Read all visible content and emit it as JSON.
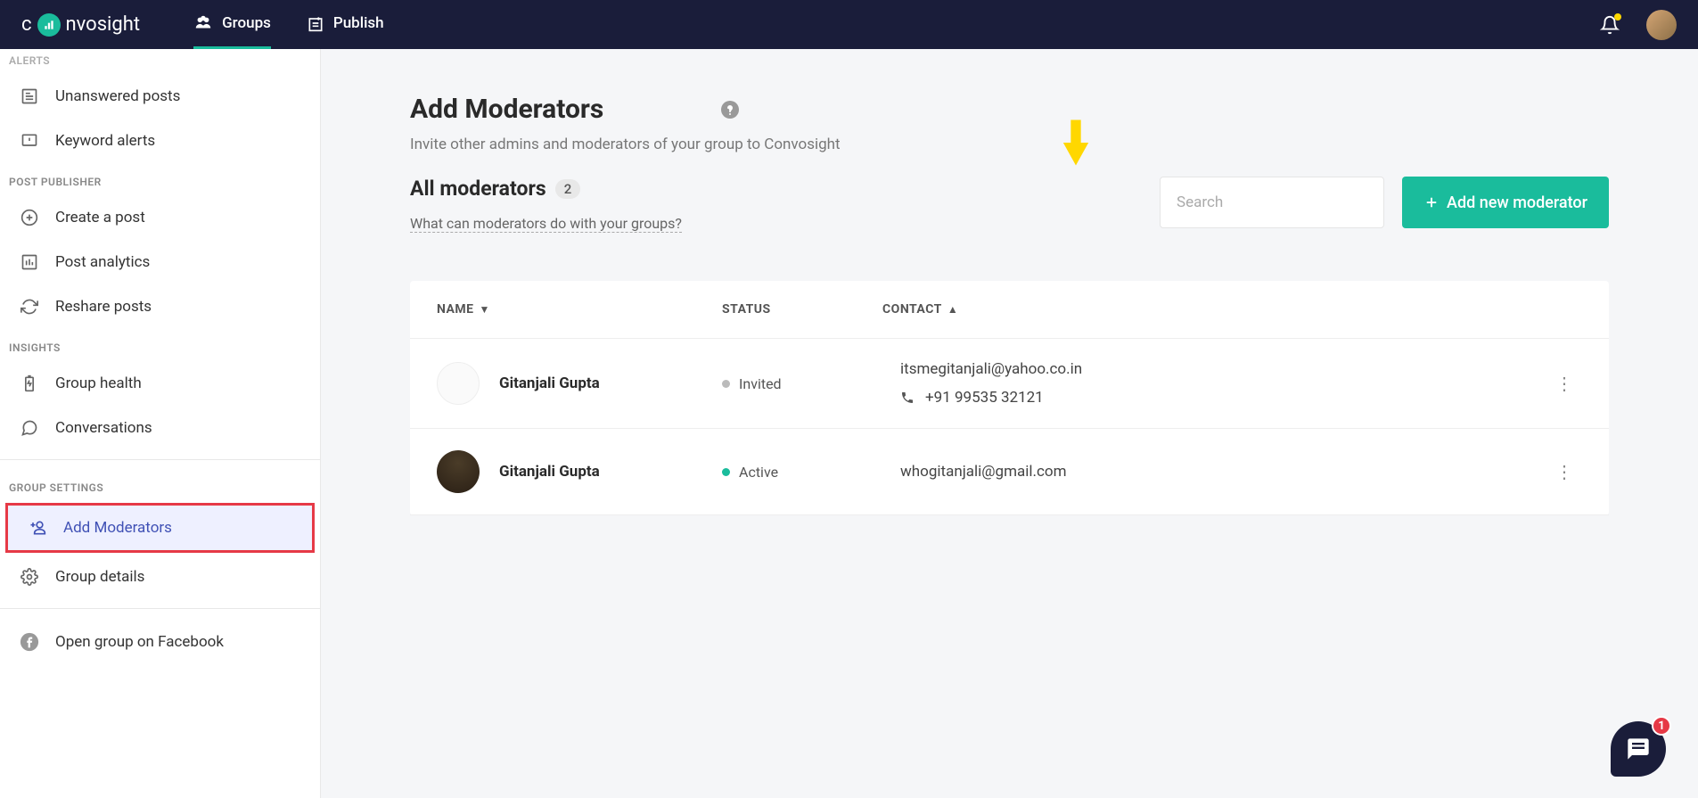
{
  "brand": {
    "name_pre": "c",
    "name_post": "nvosight"
  },
  "nav": {
    "groups": "Groups",
    "publish": "Publish"
  },
  "sidebar": {
    "section_alerts": "ALERTS",
    "unanswered": "Unanswered posts",
    "keyword_alerts": "Keyword alerts",
    "section_publisher": "POST PUBLISHER",
    "create_post": "Create a post",
    "post_analytics": "Post analytics",
    "reshare": "Reshare posts",
    "section_insights": "INSIGHTS",
    "group_health": "Group health",
    "conversations": "Conversations",
    "section_settings": "GROUP SETTINGS",
    "add_mods": "Add Moderators",
    "group_details": "Group details",
    "open_fb": "Open group on Facebook"
  },
  "page": {
    "title": "Add Moderators",
    "subtitle": "Invite other admins and moderators of your group to Convosight",
    "all_mods": "All moderators",
    "count": "2",
    "hint": "What can moderators do with your groups?",
    "search_placeholder": "Search",
    "add_btn": "Add new moderator"
  },
  "table": {
    "h_name": "NAME",
    "h_status": "STATUS",
    "h_contact": "CONTACT",
    "rows": [
      {
        "name": "Gitanjali Gupta",
        "status": "Invited",
        "email": "itsmegitanjali@yahoo.co.in",
        "phone": "+91 99535 32121",
        "avatar_blank": true
      },
      {
        "name": "Gitanjali Gupta",
        "status": "Active",
        "email": "whogitanjali@gmail.com",
        "phone": "",
        "avatar_blank": false
      }
    ]
  },
  "chat_badge": "1"
}
